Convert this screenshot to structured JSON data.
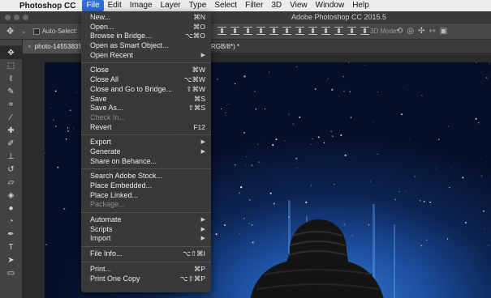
{
  "menubar": {
    "apple_icon": "apple-logo-icon",
    "app_name": "Photoshop CC",
    "items": [
      "File",
      "Edit",
      "Image",
      "Layer",
      "Type",
      "Select",
      "Filter",
      "3D",
      "View",
      "Window",
      "Help"
    ],
    "active_item": "File",
    "active_color": "#2f6fd8"
  },
  "window": {
    "title": "Adobe Photoshop CC 2015.5"
  },
  "options_bar": {
    "move_tool_icon": "move-icon",
    "auto_select_label": "Auto-Select:",
    "mode_3d_label": "3D Mode:"
  },
  "document_tab": {
    "name": "photo-14553835",
    "mode_suffix": "RGB/8*) *"
  },
  "file_menu": {
    "groups": [
      [
        {
          "label": "New...",
          "shortcut": "⌘N"
        },
        {
          "label": "Open...",
          "shortcut": "⌘O"
        },
        {
          "label": "Browse in Bridge...",
          "shortcut": "⌥⌘O"
        },
        {
          "label": "Open as Smart Object...",
          "shortcut": ""
        },
        {
          "label": "Open Recent",
          "submenu": true
        }
      ],
      [
        {
          "label": "Close",
          "shortcut": "⌘W"
        },
        {
          "label": "Close All",
          "shortcut": "⌥⌘W"
        },
        {
          "label": "Close and Go to Bridge...",
          "shortcut": "⇧⌘W"
        },
        {
          "label": "Save",
          "shortcut": "⌘S"
        },
        {
          "label": "Save As...",
          "shortcut": "⇧⌘S"
        },
        {
          "label": "Check In...",
          "shortcut": "",
          "disabled": true
        },
        {
          "label": "Revert",
          "shortcut": "F12"
        }
      ],
      [
        {
          "label": "Export",
          "submenu": true
        },
        {
          "label": "Generate",
          "submenu": true
        },
        {
          "label": "Share on Behance...",
          "shortcut": ""
        }
      ],
      [
        {
          "label": "Search Adobe Stock...",
          "shortcut": ""
        },
        {
          "label": "Place Embedded...",
          "shortcut": ""
        },
        {
          "label": "Place Linked...",
          "shortcut": ""
        },
        {
          "label": "Package...",
          "shortcut": "",
          "disabled": true
        }
      ],
      [
        {
          "label": "Automate",
          "submenu": true
        },
        {
          "label": "Scripts",
          "submenu": true
        },
        {
          "label": "Import",
          "submenu": true
        }
      ],
      [
        {
          "label": "File Info...",
          "shortcut": "⌥⇧⌘I"
        }
      ],
      [
        {
          "label": "Print...",
          "shortcut": "⌘P"
        },
        {
          "label": "Print One Copy",
          "shortcut": "⌥⇧⌘P"
        }
      ]
    ]
  },
  "tools": [
    {
      "icon": "move-tool-icon",
      "glyph": "✥",
      "selected": true
    },
    {
      "icon": "marquee-tool-icon",
      "glyph": "⬚"
    },
    {
      "icon": "lasso-tool-icon",
      "glyph": "ℓ"
    },
    {
      "icon": "quick-select-tool-icon",
      "glyph": "✎"
    },
    {
      "icon": "crop-tool-icon",
      "glyph": "⌗"
    },
    {
      "icon": "eyedropper-tool-icon",
      "glyph": "⁄"
    },
    {
      "icon": "healing-brush-tool-icon",
      "glyph": "✚"
    },
    {
      "icon": "brush-tool-icon",
      "glyph": "✐"
    },
    {
      "icon": "clone-stamp-tool-icon",
      "glyph": "⊥"
    },
    {
      "icon": "history-brush-tool-icon",
      "glyph": "↺"
    },
    {
      "icon": "eraser-tool-icon",
      "glyph": "▱"
    },
    {
      "icon": "paint-bucket-tool-icon",
      "glyph": "◈"
    },
    {
      "icon": "blur-tool-icon",
      "glyph": "●"
    },
    {
      "icon": "dodge-tool-icon",
      "glyph": "◔"
    },
    {
      "icon": "pen-tool-icon",
      "glyph": "✒"
    },
    {
      "icon": "type-tool-icon",
      "glyph": "T"
    },
    {
      "icon": "path-select-tool-icon",
      "glyph": "➤"
    },
    {
      "icon": "rectangle-tool-icon",
      "glyph": "▭"
    }
  ],
  "colors": {
    "sky_top": "#060f2a",
    "sky_glow": "#3b7ed6",
    "jacket": "#141414"
  }
}
